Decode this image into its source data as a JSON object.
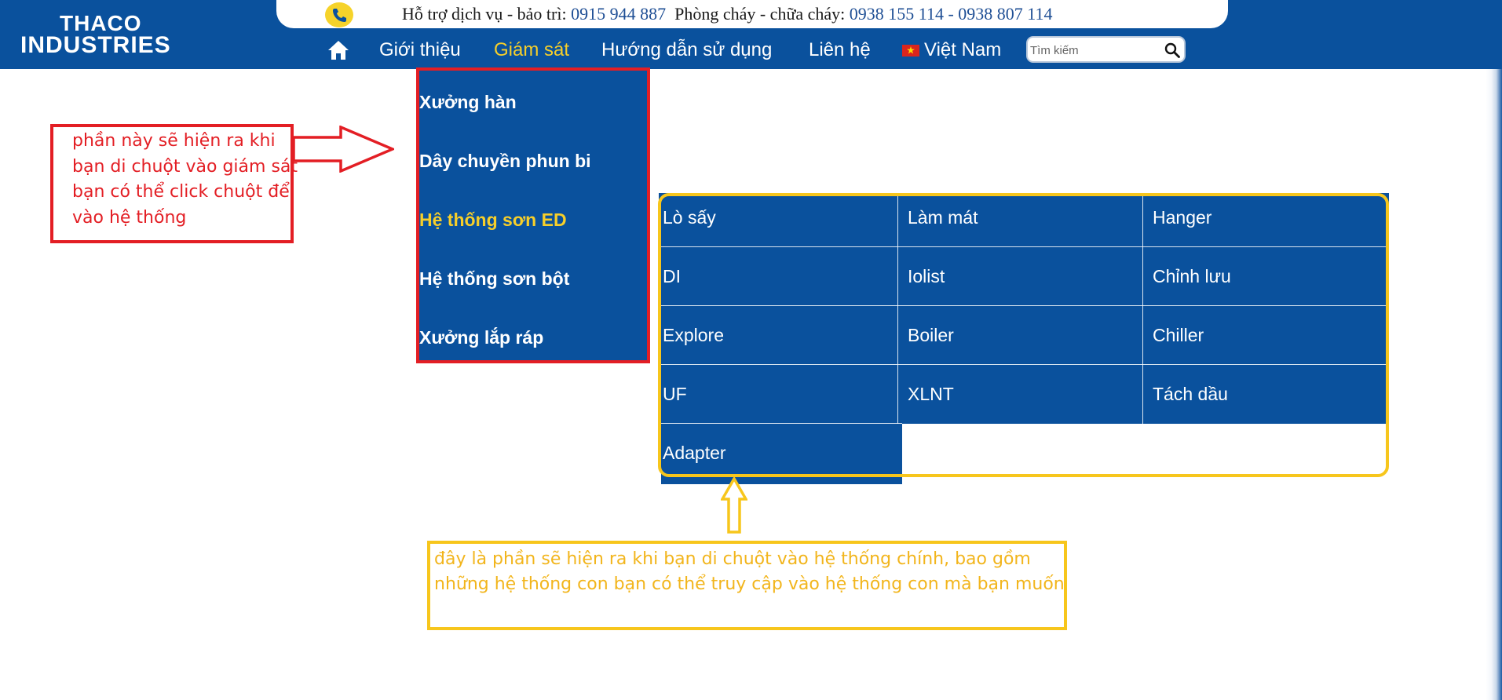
{
  "logo": {
    "line1": "THACO",
    "line2": "INDUSTRIES"
  },
  "support": {
    "service_label": "Hỗ trợ dịch vụ - bảo trì:",
    "service_phone": "0915 944 887",
    "fire_label": "Phòng cháy - chữa cháy:",
    "fire_phone_1": "0938 155 114",
    "fire_separator": "-",
    "fire_phone_2": "0938 807 114",
    "icon": "phone-icon"
  },
  "nav": {
    "items": [
      {
        "label": "Giới thiệu",
        "active": false
      },
      {
        "label": "Giám sát",
        "active": true
      },
      {
        "label": "Hướng dẫn sử dụng",
        "active": false
      },
      {
        "label": "Liên hệ",
        "active": false
      }
    ],
    "language": "Việt Nam",
    "search": {
      "placeholder": "Tìm kiếm",
      "value": ""
    }
  },
  "monitor_menu": {
    "items": [
      {
        "label": "Xưởng hàn",
        "active": false
      },
      {
        "label": "Dây chuyền phun bi",
        "active": false
      },
      {
        "label": "Hệ thống sơn ED",
        "active": true
      },
      {
        "label": "Hệ thống sơn bột",
        "active": false
      },
      {
        "label": "Xưởng lắp ráp",
        "active": false
      }
    ]
  },
  "submenu": {
    "items": [
      "Lò sấy",
      "Làm mát",
      "Hanger",
      "DI",
      "Iolist",
      "Chỉnh lưu",
      "Explore",
      "Boiler",
      "Chiller",
      "UF",
      "XLNT",
      "Tách dầu",
      "Adapter"
    ]
  },
  "annotations": {
    "red": {
      "lines": [
        "phần này sẽ hiện ra khi",
        "bạn di chuột vào giám sát",
        "bạn có thể click chuột để",
        "vào hệ thống"
      ],
      "color": "#e31e24"
    },
    "yellow": {
      "lines": [
        "đây là phần sẽ hiện ra khi bạn di chuột vào hệ thống chính, bao gồm",
        "những hệ thống con bạn có thể truy cập vào hệ thống con mà bạn muốn"
      ],
      "color": "#f7c61c"
    }
  },
  "colors": {
    "brand_blue": "#0a519d",
    "accent_yellow": "#f7cf2a",
    "annotation_red": "#e31e24"
  }
}
